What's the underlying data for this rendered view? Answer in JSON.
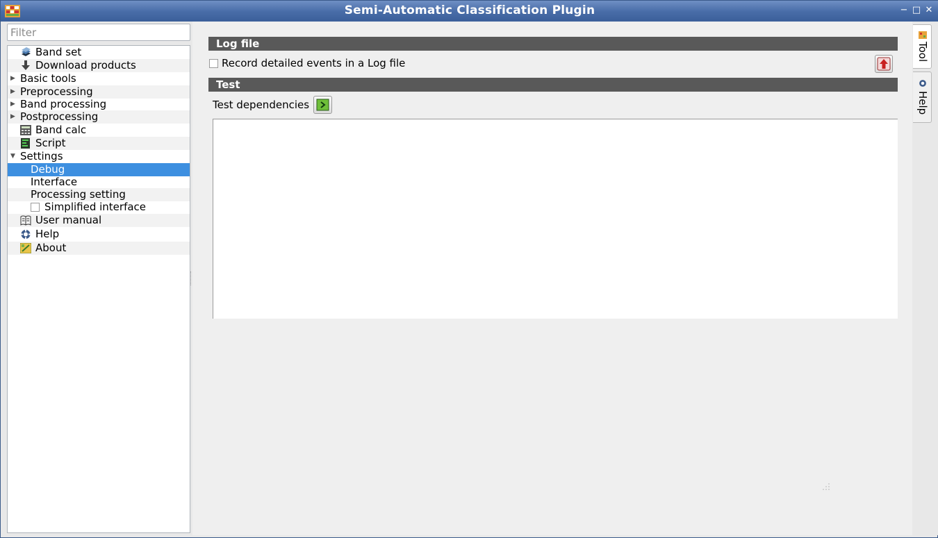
{
  "window": {
    "title": "Semi-Automatic Classification Plugin"
  },
  "filter": {
    "placeholder": "Filter"
  },
  "tree": {
    "items": [
      {
        "label": "Band set"
      },
      {
        "label": "Download products"
      },
      {
        "label": "Basic tools"
      },
      {
        "label": "Preprocessing"
      },
      {
        "label": "Band processing"
      },
      {
        "label": "Postprocessing"
      },
      {
        "label": "Band calc"
      },
      {
        "label": "Script"
      },
      {
        "label": "Settings"
      },
      {
        "label": "Debug"
      },
      {
        "label": "Interface"
      },
      {
        "label": "Processing setting"
      },
      {
        "label": "Simplified interface",
        "checked": false
      },
      {
        "label": "User manual"
      },
      {
        "label": "Help"
      },
      {
        "label": "About"
      }
    ],
    "selected": "Debug"
  },
  "main": {
    "log_section": "Log file",
    "log_checkbox_label": "Record detailed events in a Log file",
    "log_checkbox_checked": false,
    "test_section": "Test",
    "test_label": "Test dependencies",
    "output_text": ""
  },
  "dock": {
    "tabs": [
      {
        "label": "Tool",
        "active": true
      },
      {
        "label": "Help",
        "active": false
      }
    ]
  },
  "colors": {
    "titlebar": "#4a6ea9",
    "selection": "#3d8fe0",
    "section_bar": "#595959"
  }
}
